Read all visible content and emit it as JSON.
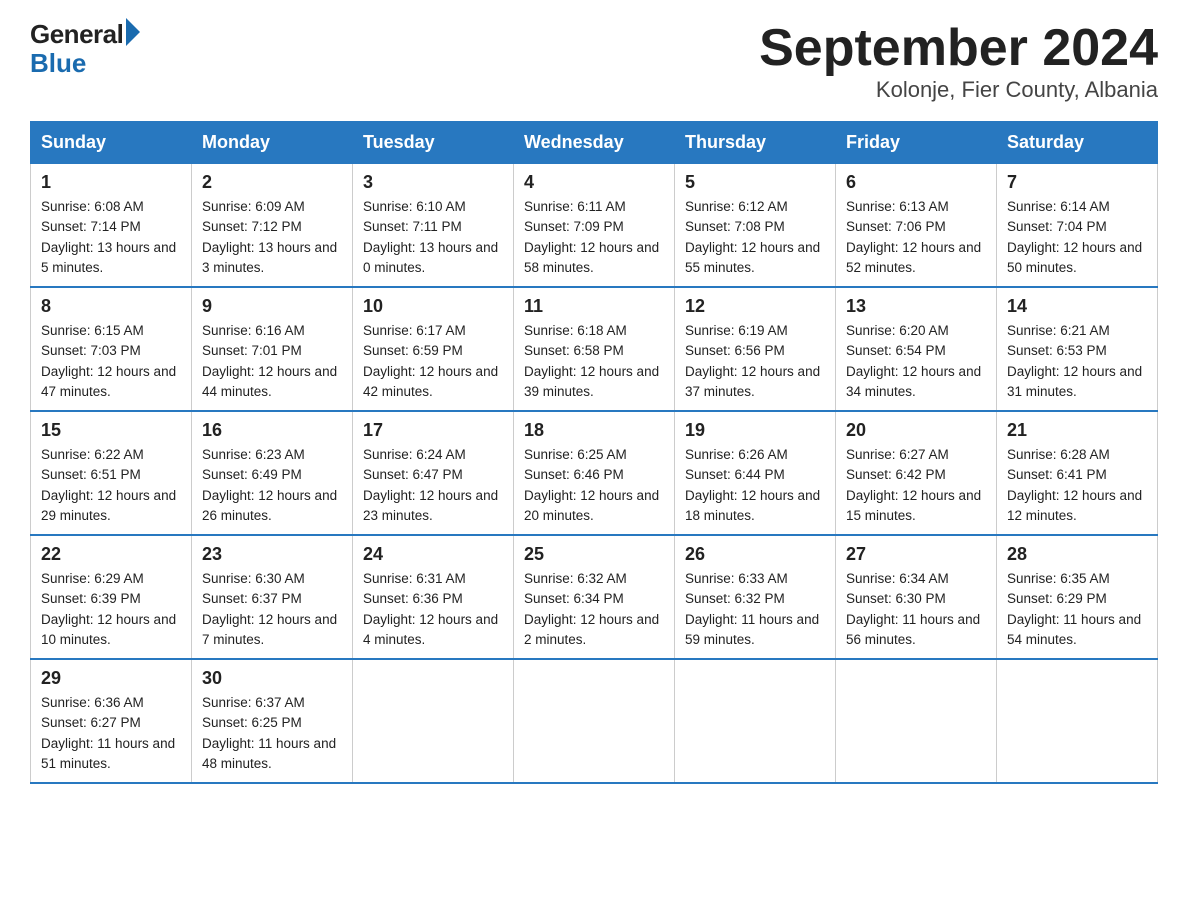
{
  "header": {
    "logo_general": "General",
    "logo_blue": "Blue",
    "title": "September 2024",
    "subtitle": "Kolonje, Fier County, Albania"
  },
  "weekdays": [
    "Sunday",
    "Monday",
    "Tuesday",
    "Wednesday",
    "Thursday",
    "Friday",
    "Saturday"
  ],
  "weeks": [
    [
      {
        "day": "1",
        "sunrise": "6:08 AM",
        "sunset": "7:14 PM",
        "daylight": "13 hours and 5 minutes."
      },
      {
        "day": "2",
        "sunrise": "6:09 AM",
        "sunset": "7:12 PM",
        "daylight": "13 hours and 3 minutes."
      },
      {
        "day": "3",
        "sunrise": "6:10 AM",
        "sunset": "7:11 PM",
        "daylight": "13 hours and 0 minutes."
      },
      {
        "day": "4",
        "sunrise": "6:11 AM",
        "sunset": "7:09 PM",
        "daylight": "12 hours and 58 minutes."
      },
      {
        "day": "5",
        "sunrise": "6:12 AM",
        "sunset": "7:08 PM",
        "daylight": "12 hours and 55 minutes."
      },
      {
        "day": "6",
        "sunrise": "6:13 AM",
        "sunset": "7:06 PM",
        "daylight": "12 hours and 52 minutes."
      },
      {
        "day": "7",
        "sunrise": "6:14 AM",
        "sunset": "7:04 PM",
        "daylight": "12 hours and 50 minutes."
      }
    ],
    [
      {
        "day": "8",
        "sunrise": "6:15 AM",
        "sunset": "7:03 PM",
        "daylight": "12 hours and 47 minutes."
      },
      {
        "day": "9",
        "sunrise": "6:16 AM",
        "sunset": "7:01 PM",
        "daylight": "12 hours and 44 minutes."
      },
      {
        "day": "10",
        "sunrise": "6:17 AM",
        "sunset": "6:59 PM",
        "daylight": "12 hours and 42 minutes."
      },
      {
        "day": "11",
        "sunrise": "6:18 AM",
        "sunset": "6:58 PM",
        "daylight": "12 hours and 39 minutes."
      },
      {
        "day": "12",
        "sunrise": "6:19 AM",
        "sunset": "6:56 PM",
        "daylight": "12 hours and 37 minutes."
      },
      {
        "day": "13",
        "sunrise": "6:20 AM",
        "sunset": "6:54 PM",
        "daylight": "12 hours and 34 minutes."
      },
      {
        "day": "14",
        "sunrise": "6:21 AM",
        "sunset": "6:53 PM",
        "daylight": "12 hours and 31 minutes."
      }
    ],
    [
      {
        "day": "15",
        "sunrise": "6:22 AM",
        "sunset": "6:51 PM",
        "daylight": "12 hours and 29 minutes."
      },
      {
        "day": "16",
        "sunrise": "6:23 AM",
        "sunset": "6:49 PM",
        "daylight": "12 hours and 26 minutes."
      },
      {
        "day": "17",
        "sunrise": "6:24 AM",
        "sunset": "6:47 PM",
        "daylight": "12 hours and 23 minutes."
      },
      {
        "day": "18",
        "sunrise": "6:25 AM",
        "sunset": "6:46 PM",
        "daylight": "12 hours and 20 minutes."
      },
      {
        "day": "19",
        "sunrise": "6:26 AM",
        "sunset": "6:44 PM",
        "daylight": "12 hours and 18 minutes."
      },
      {
        "day": "20",
        "sunrise": "6:27 AM",
        "sunset": "6:42 PM",
        "daylight": "12 hours and 15 minutes."
      },
      {
        "day": "21",
        "sunrise": "6:28 AM",
        "sunset": "6:41 PM",
        "daylight": "12 hours and 12 minutes."
      }
    ],
    [
      {
        "day": "22",
        "sunrise": "6:29 AM",
        "sunset": "6:39 PM",
        "daylight": "12 hours and 10 minutes."
      },
      {
        "day": "23",
        "sunrise": "6:30 AM",
        "sunset": "6:37 PM",
        "daylight": "12 hours and 7 minutes."
      },
      {
        "day": "24",
        "sunrise": "6:31 AM",
        "sunset": "6:36 PM",
        "daylight": "12 hours and 4 minutes."
      },
      {
        "day": "25",
        "sunrise": "6:32 AM",
        "sunset": "6:34 PM",
        "daylight": "12 hours and 2 minutes."
      },
      {
        "day": "26",
        "sunrise": "6:33 AM",
        "sunset": "6:32 PM",
        "daylight": "11 hours and 59 minutes."
      },
      {
        "day": "27",
        "sunrise": "6:34 AM",
        "sunset": "6:30 PM",
        "daylight": "11 hours and 56 minutes."
      },
      {
        "day": "28",
        "sunrise": "6:35 AM",
        "sunset": "6:29 PM",
        "daylight": "11 hours and 54 minutes."
      }
    ],
    [
      {
        "day": "29",
        "sunrise": "6:36 AM",
        "sunset": "6:27 PM",
        "daylight": "11 hours and 51 minutes."
      },
      {
        "day": "30",
        "sunrise": "6:37 AM",
        "sunset": "6:25 PM",
        "daylight": "11 hours and 48 minutes."
      },
      null,
      null,
      null,
      null,
      null
    ]
  ],
  "labels": {
    "sunrise_prefix": "Sunrise: ",
    "sunset_prefix": "Sunset: ",
    "daylight_prefix": "Daylight: "
  }
}
